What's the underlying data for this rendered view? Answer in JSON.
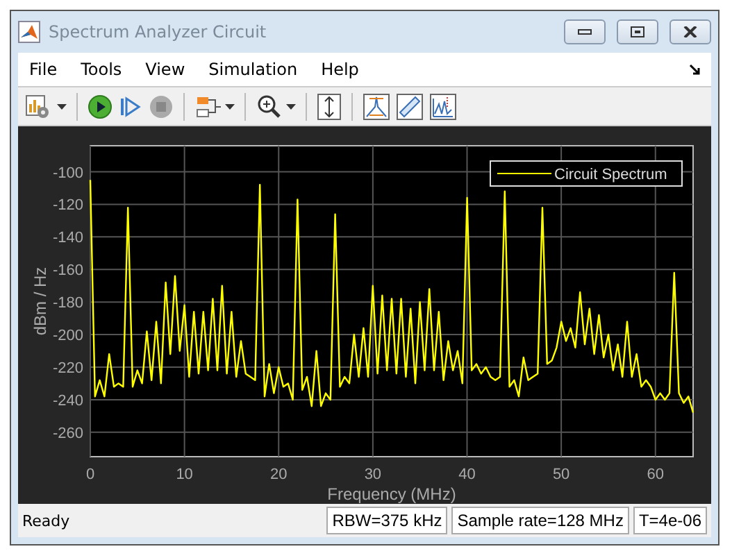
{
  "window": {
    "title": "Spectrum Analyzer Circuit"
  },
  "menu": [
    "File",
    "Tools",
    "View",
    "Simulation",
    "Help"
  ],
  "plot": {
    "chart_data": {
      "type": "line",
      "grid": true,
      "xlabel": "Frequency (MHz)",
      "ylabel": "dBm / Hz",
      "xlim": [
        0,
        64
      ],
      "ylim": [
        -275,
        -84
      ],
      "xticks": [
        0,
        10,
        20,
        30,
        40,
        50,
        60
      ],
      "yticks": [
        -260,
        -240,
        -220,
        -200,
        -180,
        -160,
        -140,
        -120,
        -100
      ],
      "x": [
        0,
        0.5,
        1,
        1.5,
        2,
        2.5,
        3,
        3.5,
        4,
        4.5,
        5,
        5.5,
        6,
        6.5,
        7,
        7.5,
        8,
        8.5,
        9,
        9.5,
        10,
        10.5,
        11,
        11.5,
        12,
        12.5,
        13,
        13.5,
        14,
        14.5,
        15,
        15.5,
        16,
        16.5,
        17,
        17.5,
        18,
        18.5,
        19,
        19.5,
        20,
        20.5,
        21,
        21.5,
        22,
        22.5,
        23,
        23.5,
        24,
        24.5,
        25,
        25.5,
        26,
        26.5,
        27,
        27.5,
        28,
        28.5,
        29,
        29.5,
        30,
        30.5,
        31,
        31.5,
        32,
        32.5,
        33,
        33.5,
        34,
        34.5,
        35,
        35.5,
        36,
        36.5,
        37,
        37.5,
        38,
        38.5,
        39,
        39.5,
        40,
        40.5,
        41,
        41.5,
        42,
        42.5,
        43,
        43.5,
        44,
        44.5,
        45,
        45.5,
        46,
        46.5,
        47,
        47.5,
        48,
        48.5,
        49,
        49.5,
        50,
        50.5,
        51,
        51.5,
        52,
        52.5,
        53,
        53.5,
        54,
        54.5,
        55,
        55.5,
        56,
        56.5,
        57,
        57.5,
        58,
        58.5,
        59,
        59.5,
        60,
        60.5,
        61,
        61.5,
        62,
        62.5,
        63,
        63.5,
        64
      ],
      "series": [
        {
          "name": "Circuit Spectrum",
          "color": "#ffff00",
          "values": [
            -105,
            -238,
            -228,
            -238,
            -212,
            -232,
            -230,
            -232,
            -122,
            -232,
            -222,
            -230,
            -198,
            -228,
            -192,
            -230,
            -168,
            -212,
            -164,
            -210,
            -182,
            -226,
            -186,
            -224,
            -186,
            -222,
            -178,
            -222,
            -170,
            -224,
            -186,
            -226,
            -204,
            -224,
            -226,
            -228,
            -108,
            -238,
            -218,
            -236,
            -220,
            -232,
            -230,
            -240,
            -117,
            -234,
            -226,
            -244,
            -210,
            -244,
            -236,
            -240,
            -126,
            -232,
            -226,
            -230,
            -200,
            -226,
            -196,
            -226,
            -170,
            -224,
            -176,
            -222,
            -178,
            -224,
            -178,
            -226,
            -184,
            -230,
            -180,
            -222,
            -172,
            -222,
            -186,
            -228,
            -204,
            -222,
            -210,
            -230,
            -116,
            -222,
            -218,
            -224,
            -220,
            -226,
            -228,
            -226,
            -112,
            -232,
            -228,
            -238,
            -214,
            -228,
            -226,
            -224,
            -122,
            -218,
            -216,
            -208,
            -192,
            -204,
            -196,
            -208,
            -174,
            -206,
            -184,
            -212,
            -188,
            -214,
            -200,
            -222,
            -206,
            -226,
            -192,
            -226,
            -212,
            -232,
            -228,
            -232,
            -240,
            -236,
            -240,
            -236,
            -162,
            -236,
            -242,
            -238,
            -248
          ]
        }
      ]
    }
  },
  "status_bar": {
    "message": "Ready",
    "fields": [
      "RBW=375 kHz",
      "Sample rate=128 MHz",
      "T=4e-06"
    ]
  }
}
